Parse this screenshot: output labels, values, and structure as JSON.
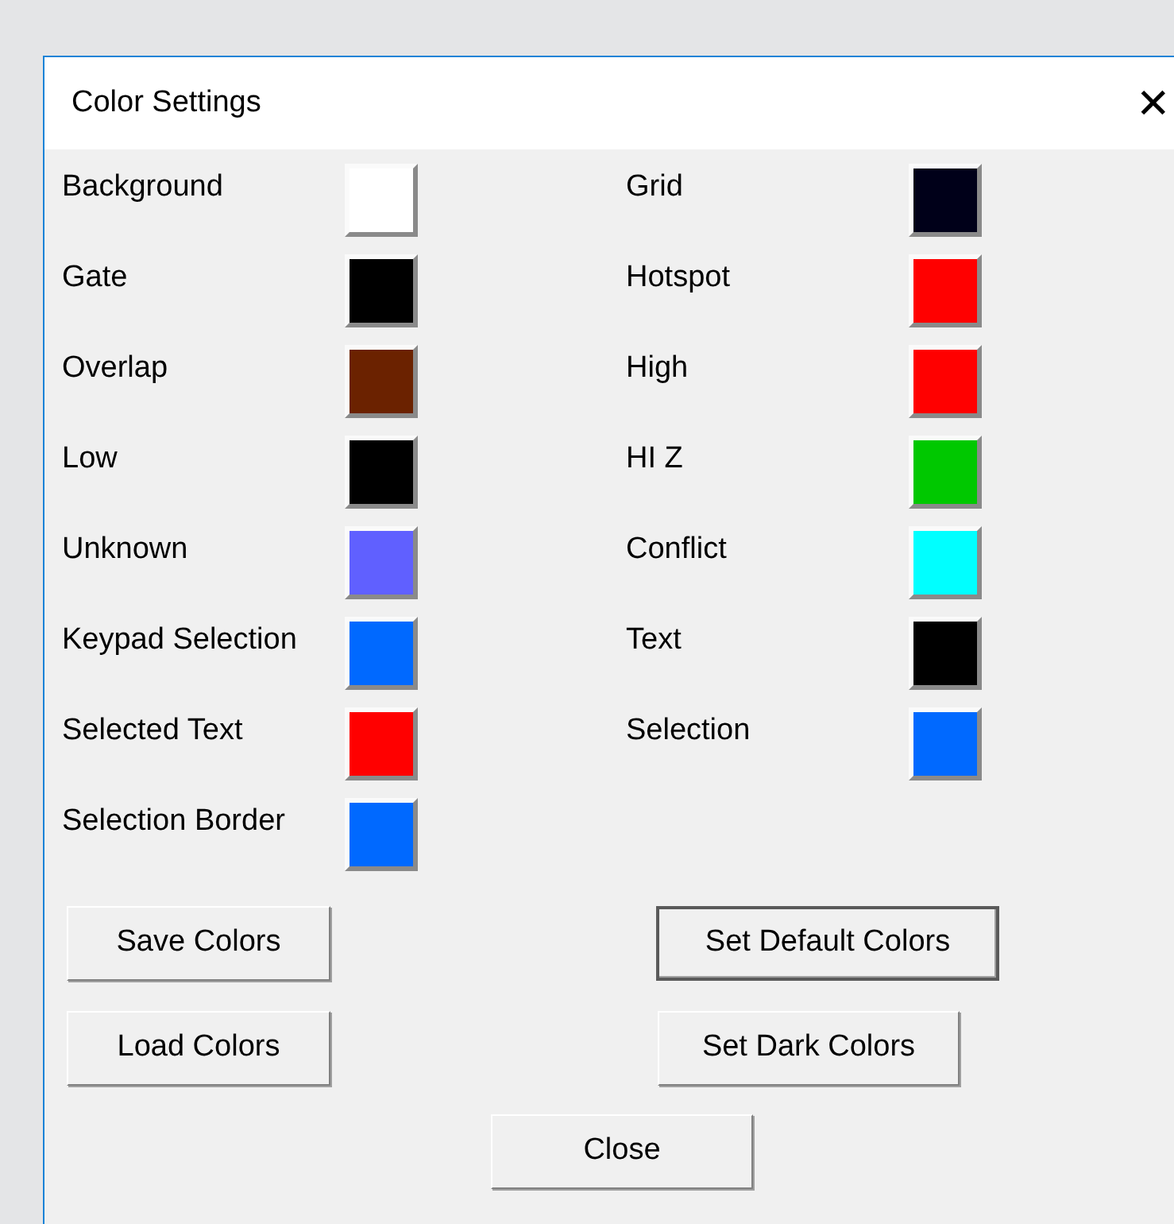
{
  "window": {
    "title": "Color Settings",
    "close_glyph": "✕"
  },
  "columns": [
    [
      {
        "label": "Background",
        "color": "#ffffff"
      },
      {
        "label": "Gate",
        "color": "#000000"
      },
      {
        "label": "Overlap",
        "color": "#6b2200"
      },
      {
        "label": "Low",
        "color": "#000000"
      },
      {
        "label": "Unknown",
        "color": "#6060ff"
      },
      {
        "label": "Keypad Selection",
        "color": "#0069ff"
      },
      {
        "label": "Selected Text",
        "color": "#ff0000"
      },
      {
        "label": "Selection Border",
        "color": "#0069ff"
      }
    ],
    [
      {
        "label": "Grid",
        "color": "#000019"
      },
      {
        "label": "Hotspot",
        "color": "#ff0000"
      },
      {
        "label": "High",
        "color": "#ff0000"
      },
      {
        "label": "HI Z",
        "color": "#00c800"
      },
      {
        "label": "Conflict",
        "color": "#00ffff"
      },
      {
        "label": "Text",
        "color": "#000000"
      },
      {
        "label": "Selection",
        "color": "#0069ff"
      }
    ]
  ],
  "buttons": [
    {
      "label": "Save Colors",
      "default": false
    },
    {
      "label": "Set Default Colors",
      "default": true
    },
    {
      "label": "Load Colors",
      "default": false
    },
    {
      "label": "Set Dark Colors",
      "default": false
    },
    {
      "label": "Close",
      "default": false
    }
  ]
}
